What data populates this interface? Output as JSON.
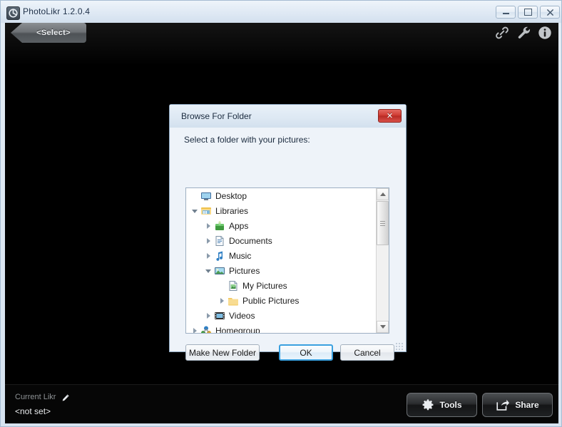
{
  "window": {
    "title": "PhotoLikr 1.2.0.4",
    "app_icon": "refresh-circle-icon",
    "controls": {
      "minimize": "minimize-icon",
      "maximize": "maximize-icon",
      "close": "close-icon"
    }
  },
  "stage": {
    "select_tab_label": "<Select>",
    "icons": [
      {
        "name": "link-icon"
      },
      {
        "name": "wrench-icon"
      },
      {
        "name": "info-icon"
      }
    ]
  },
  "footer": {
    "current_likr_label": "Current Likr",
    "edit_icon": "pencil-icon",
    "current_likr_value": "<not set>",
    "tools_label": "Tools",
    "share_label": "Share"
  },
  "dialog": {
    "title": "Browse For Folder",
    "close_glyph": "✕",
    "prompt": "Select a folder with your pictures:",
    "tree": [
      {
        "label": "Desktop",
        "indent": 0,
        "expander": "none",
        "icon": "monitor-icon",
        "selected": false
      },
      {
        "label": "Libraries",
        "indent": 0,
        "expander": "open",
        "icon": "libraries-icon",
        "selected": false
      },
      {
        "label": "Apps",
        "indent": 1,
        "expander": "closed",
        "icon": "apps-icon",
        "selected": false
      },
      {
        "label": "Documents",
        "indent": 1,
        "expander": "closed",
        "icon": "document-icon",
        "selected": false
      },
      {
        "label": "Music",
        "indent": 1,
        "expander": "closed",
        "icon": "music-note-icon",
        "selected": false
      },
      {
        "label": "Pictures",
        "indent": 1,
        "expander": "open",
        "icon": "pictures-icon",
        "selected": true
      },
      {
        "label": "My Pictures",
        "indent": 2,
        "expander": "none",
        "icon": "my-pictures-icon",
        "selected": false
      },
      {
        "label": "Public Pictures",
        "indent": 2,
        "expander": "closed",
        "icon": "folder-icon",
        "selected": false
      },
      {
        "label": "Videos",
        "indent": 1,
        "expander": "closed",
        "icon": "videos-icon",
        "selected": false
      },
      {
        "label": "Homegroup",
        "indent": 0,
        "expander": "closed",
        "icon": "homegroup-icon",
        "selected": false
      }
    ],
    "buttons": {
      "new_folder": "Make New Folder",
      "ok": "OK",
      "cancel": "Cancel"
    }
  },
  "colors": {
    "accent_blue": "#3aa0df",
    "close_red": "#cf3b33",
    "stage_black": "#000000",
    "frame": "#d6e3f0"
  }
}
